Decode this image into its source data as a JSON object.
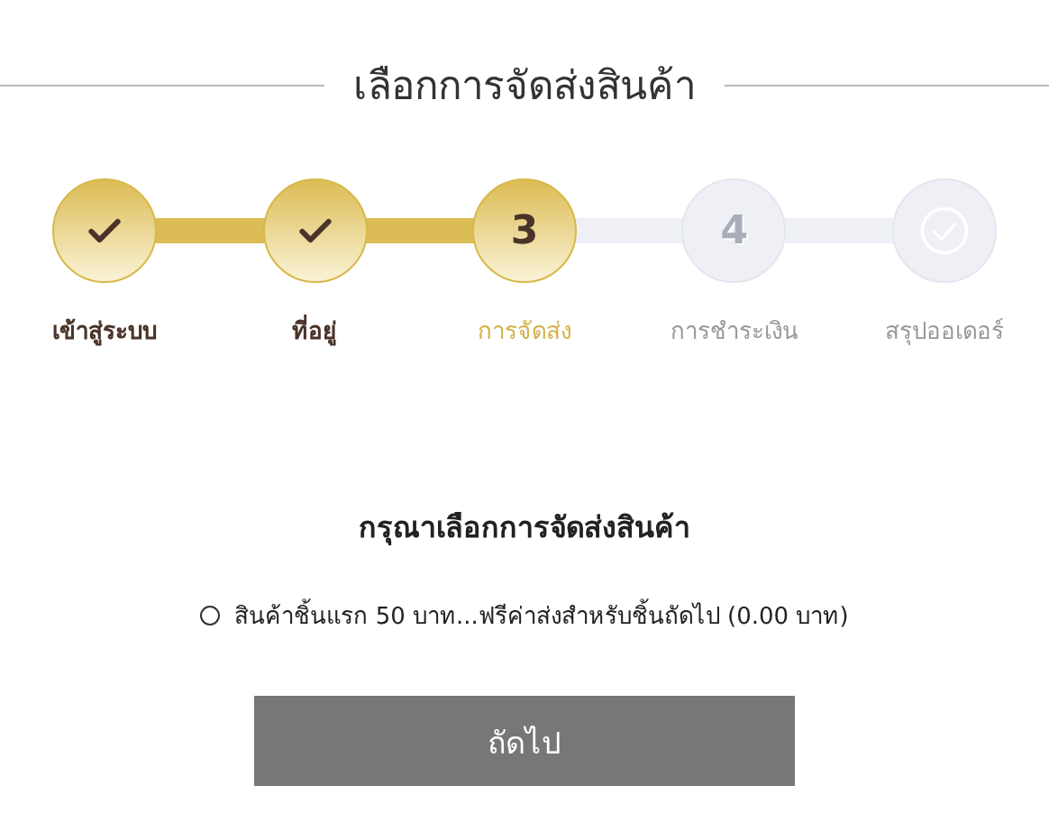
{
  "title": "เลือกการจัดส่งสินค้า",
  "steps": [
    {
      "label": "เข้าสู่ระบบ",
      "done": true,
      "current": false,
      "kind": "check"
    },
    {
      "label": "ที่อยู่",
      "done": true,
      "current": false,
      "kind": "check"
    },
    {
      "label": "การจัดส่ง",
      "done": false,
      "current": true,
      "kind": "number",
      "number": "3"
    },
    {
      "label": "การชำระเงิน",
      "done": false,
      "current": false,
      "kind": "number",
      "number": "4"
    },
    {
      "label": "สรุปออเดอร์",
      "done": false,
      "current": false,
      "kind": "check"
    }
  ],
  "heading": "กรุณาเลือกการจัดส่งสินค้า",
  "options": [
    {
      "label": "สินค้าชิ้นแรก 50 บาท...ฟรีค่าส่งสำหรับชิ้นถัดไป (0.00 บาท)",
      "selected": false
    }
  ],
  "button": "ถัดไป"
}
